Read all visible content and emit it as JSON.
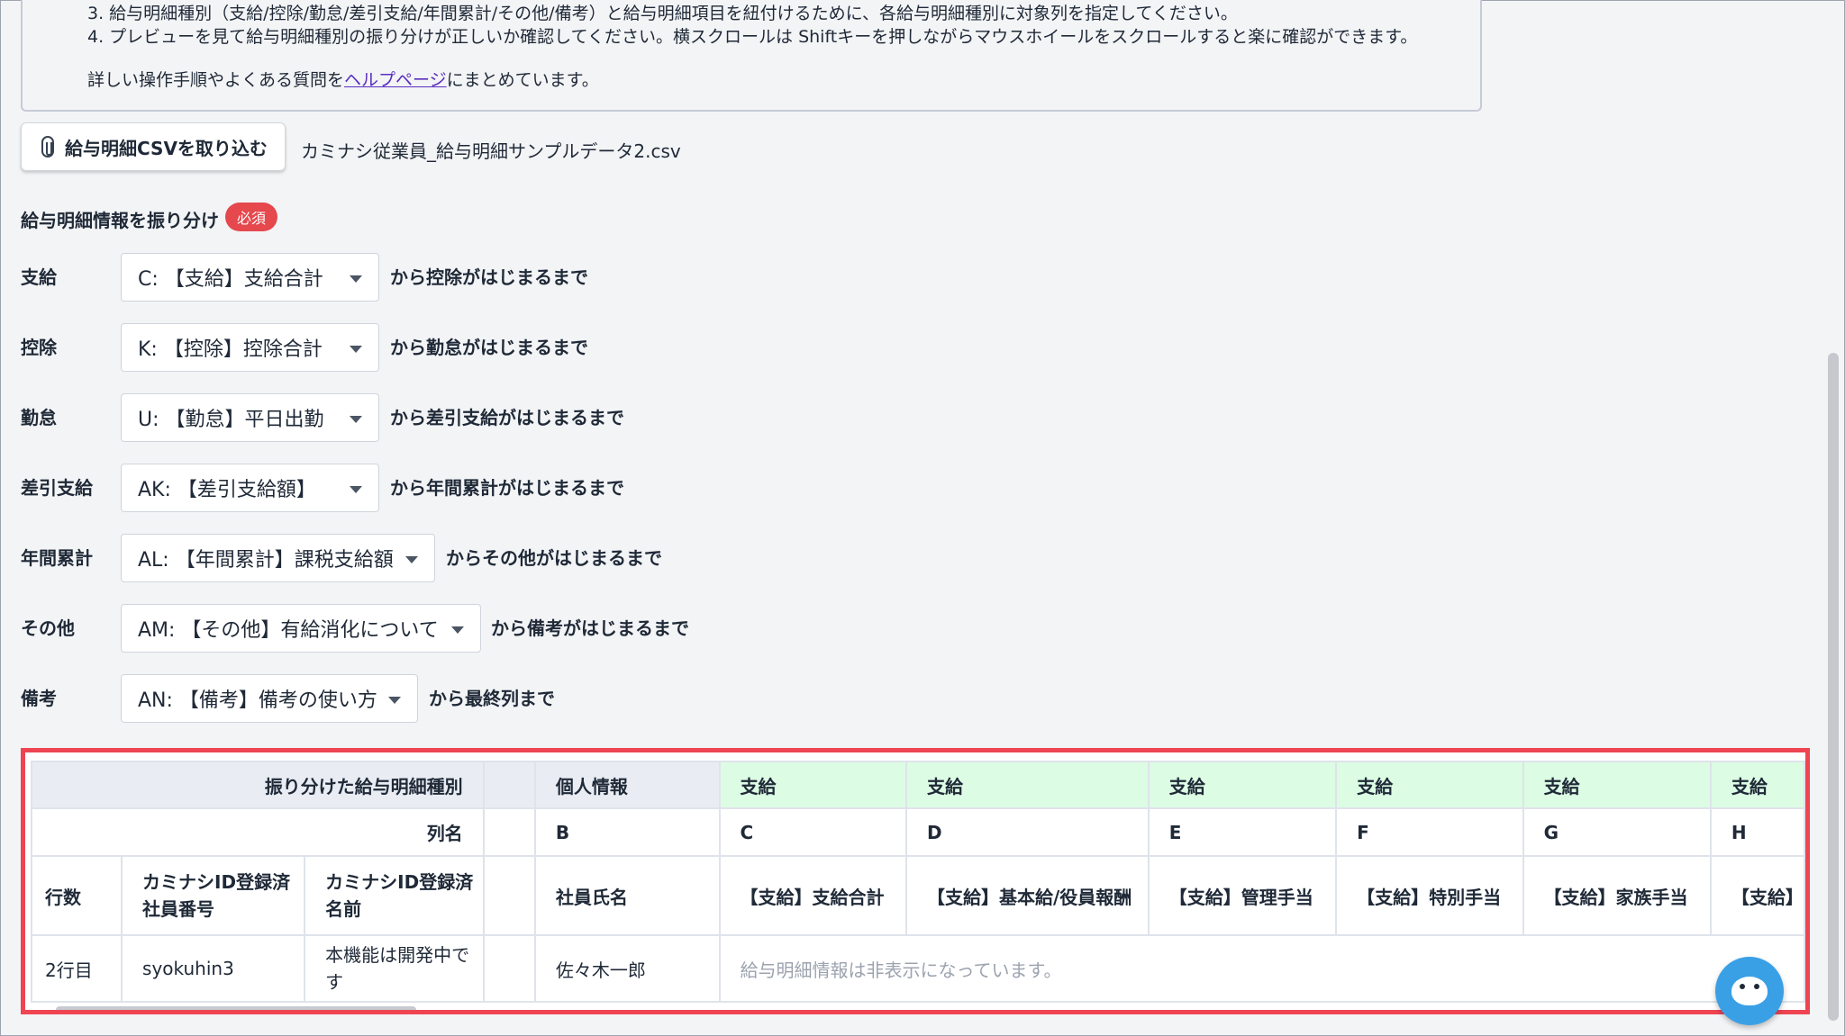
{
  "instructions": {
    "line3": "3. 給与明細種別（支給/控除/勤怠/差引支給/年間累計/その他/備考）と給与明細項目を紐付けるために、各給与明細種別に対象列を指定してください。",
    "line4": "4. プレビューを見て給与明細種別の振り分けが正しいか確認してください。横スクロールは Shiftキーを押しながらマウスホイールをスクロールすると楽に確認ができます。",
    "help_prefix": "詳しい操作手順やよくある質問を",
    "help_link": "ヘルプページ",
    "help_suffix": "にまとめています。"
  },
  "upload": {
    "button_label": "給与明細CSVを取り込む",
    "file_name": "カミナシ従業員_給与明細サンプルデータ2.csv"
  },
  "mapping": {
    "title": "給与明細情報を振り分け",
    "required_badge": "必須",
    "rows": [
      {
        "label": "支給",
        "value": "C: 【支給】支給合計",
        "suffix": "から控除がはじまるまで"
      },
      {
        "label": "控除",
        "value": "K: 【控除】控除合計",
        "suffix": "から勤怠がはじまるまで"
      },
      {
        "label": "勤怠",
        "value": "U: 【勤怠】平日出勤",
        "suffix": "から差引支給がはじまるまで"
      },
      {
        "label": "差引支給",
        "value": "AK: 【差引支給額】",
        "suffix": "から年間累計がはじまるまで"
      },
      {
        "label": "年間累計",
        "value": "AL: 【年間累計】課税支給額",
        "suffix": "からその他がはじまるまで"
      },
      {
        "label": "その他",
        "value": "AM: 【その他】有給消化について",
        "suffix": "から備考がはじまるまで"
      },
      {
        "label": "備考",
        "value": "AN: 【備考】備考の使い方",
        "suffix": "から最終列まで"
      }
    ]
  },
  "preview": {
    "category_header": "振り分けた給与明細種別",
    "column_header": "列名",
    "categories": [
      "個人情報",
      "支給",
      "支給",
      "支給",
      "支給",
      "支給",
      "支給"
    ],
    "columns": [
      "B",
      "C",
      "D",
      "E",
      "F",
      "G",
      "H"
    ],
    "headers": {
      "row_count": "行数",
      "employee_no": "カミナシID登録済社員番号",
      "name": "カミナシID登録済名前",
      "items": [
        "社員氏名",
        "【支給】支給合計",
        "【支給】基本給/役員報酬",
        "【支給】管理手当",
        "【支給】特別手当",
        "【支給】家族手当",
        "【支給】"
      ]
    },
    "data_row": {
      "row": "2行目",
      "employee_no": "syokuhin3",
      "name": "本機能は開発中です",
      "employee_name": "佐々木一郎",
      "hidden_note": "給与明細情報は非表示になっています。"
    }
  },
  "colors": {
    "accent_red": "#ef4553",
    "pay_green": "#dcfce4",
    "link": "#5b2fc0"
  }
}
